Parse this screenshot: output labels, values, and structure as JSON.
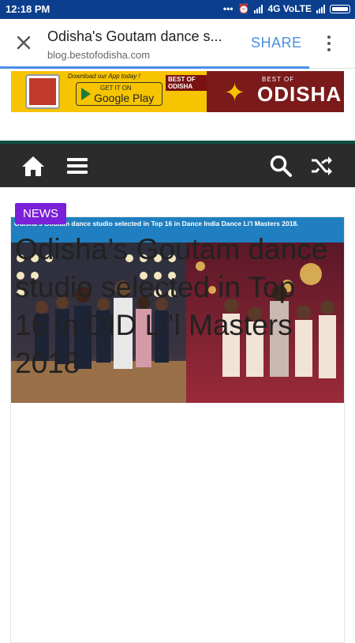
{
  "status_bar": {
    "time": "12:18 PM",
    "network": "4G VoLTE"
  },
  "toolbar": {
    "title": "Odisha's Goutam dance s...",
    "url": "blog.bestofodisha.com",
    "share_label": "SHARE"
  },
  "banner": {
    "download_text": "Download our App today !",
    "get_it_on": "GET IT ON",
    "google_play": "Google Play",
    "small_badge": "BEST OF ODISHA",
    "best_of": "BEST OF",
    "brand": "ODISHA"
  },
  "nav": {
    "icons": [
      "home-icon",
      "menu-icon",
      "search-icon",
      "shuffle-icon"
    ]
  },
  "article": {
    "image_caption": "Odisha's Goutam dance studio selected in Top 16 in Dance India Dance Li'l Masters 2018.",
    "category": "NEWS",
    "headline": "Odisha’s Goutam dance studio selected in Top 16 in DID Li’l Masters 2018"
  },
  "colors": {
    "status_bar": "#0b3f8e",
    "accent": "#4a8ee6",
    "navbar": "#2b2b2b",
    "caption_bg": "#1f7fc0",
    "tag": "#7b1fd8"
  }
}
